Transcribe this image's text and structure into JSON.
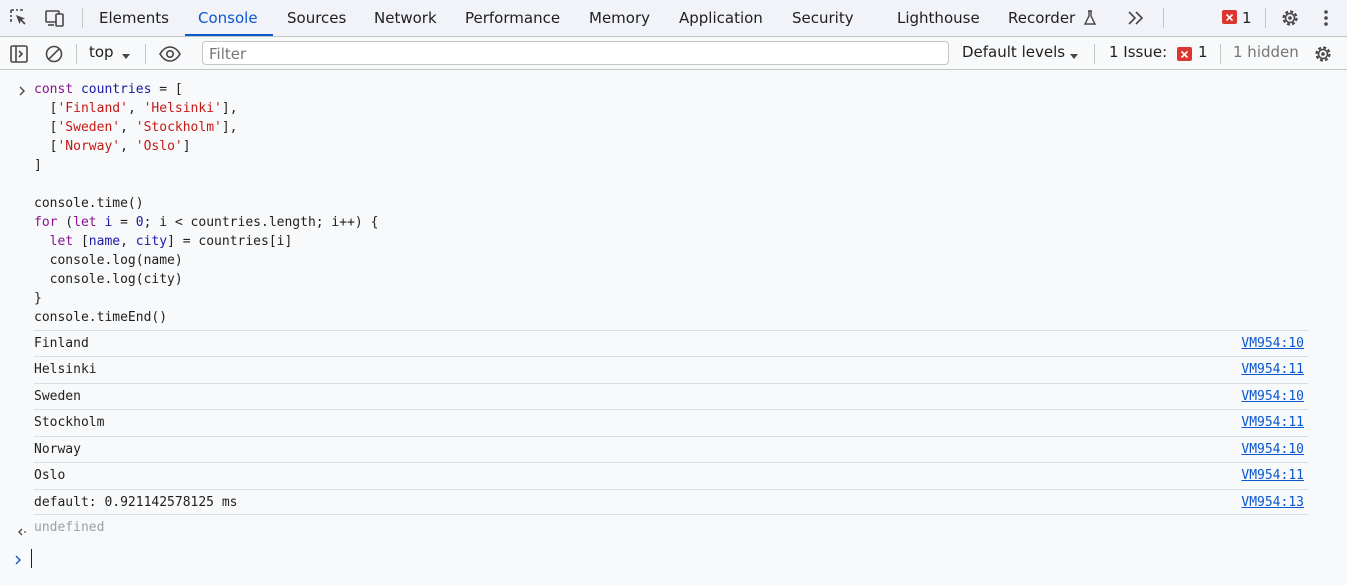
{
  "tabs": [
    {
      "label": "Elements"
    },
    {
      "label": "Console"
    },
    {
      "label": "Sources"
    },
    {
      "label": "Network"
    },
    {
      "label": "Performance"
    },
    {
      "label": "Memory"
    },
    {
      "label": "Application"
    },
    {
      "label": "Security"
    },
    {
      "label": "Lighthouse"
    },
    {
      "label": "Recorder"
    }
  ],
  "topbar": {
    "error_count": "1"
  },
  "toolbar": {
    "context": "top",
    "filter_placeholder": "Filter",
    "levels": "Default levels",
    "issues_label": "1 Issue:",
    "issues_count": "1",
    "hidden": "1 hidden"
  },
  "console": {
    "logs": [
      {
        "message": "Finland",
        "source": "VM954:10"
      },
      {
        "message": "Helsinki",
        "source": "VM954:11"
      },
      {
        "message": "Sweden",
        "source": "VM954:10"
      },
      {
        "message": "Stockholm",
        "source": "VM954:11"
      },
      {
        "message": "Norway",
        "source": "VM954:10"
      },
      {
        "message": "Oslo",
        "source": "VM954:11"
      },
      {
        "message": "default: 0.921142578125 ms",
        "source": "VM954:13"
      }
    ],
    "result": "undefined"
  },
  "colors": {
    "accent": "#0b57d0",
    "error": "#dc362e",
    "keyword": "#881391",
    "string": "#c41a16"
  },
  "icons": [
    "inspect-element-icon",
    "device-toolbar-icon",
    "flask-icon",
    "more-tabs-icon",
    "error-badge-icon",
    "settings-gear-icon",
    "more-vertical-icon",
    "sidebar-toggle-icon",
    "clear-console-icon",
    "dropdown-arrow-icon",
    "eye-icon",
    "input-chevron-icon",
    "result-arrow-icon"
  ]
}
